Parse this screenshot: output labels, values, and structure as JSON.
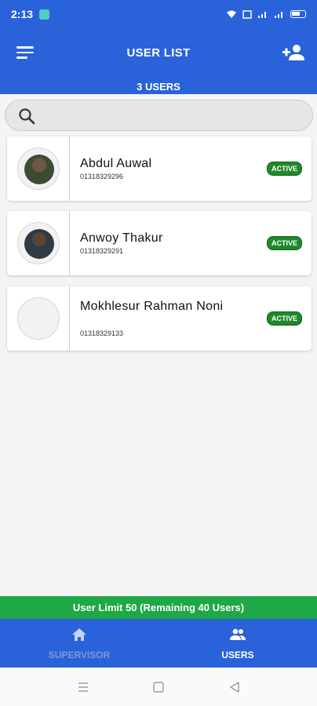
{
  "status_bar": {
    "time": "2:13",
    "icons": [
      "wifi-icon",
      "signal-icon",
      "signal-icon",
      "battery-icon"
    ]
  },
  "header": {
    "title": "USER LIST",
    "count_label": "3 USERS"
  },
  "search": {
    "placeholder": "",
    "value": ""
  },
  "users": [
    {
      "name": "Abdul Auwal",
      "phone": "01318329296",
      "status": "ACTIVE",
      "has_photo": true
    },
    {
      "name": "Anwoy Thakur",
      "phone": "01318329291",
      "status": "ACTIVE",
      "has_photo": true
    },
    {
      "name": "Mokhlesur Rahman Noni",
      "phone": "01318329133",
      "status": "ACTIVE",
      "has_photo": false
    }
  ],
  "limit_text": "User Limit 50 (Remaining 40 Users)",
  "bottom_nav": [
    {
      "label": "SUPERVISOR",
      "icon": "home-icon",
      "active": false
    },
    {
      "label": "USERS",
      "icon": "users-icon",
      "active": true
    }
  ],
  "colors": {
    "primary": "#2962d9",
    "success": "#1ea846",
    "badge": "#1f8a2b"
  }
}
